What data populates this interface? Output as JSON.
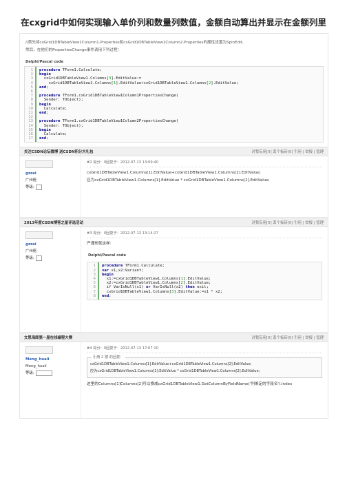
{
  "title": "在cxgrid中如何实现输入单价列和数量列数值，金额自动算出并显示在金额列里",
  "intro": [
    "//首先将cxGrid1DBTableView1Column1.Properties和cxGrid1DBTableView1Column2.Properties的属性设置为SpinEdit,",
    "然后，在他们的PropertiesChange事件调用下列过程："
  ],
  "code1": {
    "label": "Delphi/Pascal code",
    "line_numbers": "1\n2\n3\n4\n5\n6\n7\n8\n9\n10\n11\n12\n13\n14\n15\n16\n17"
  },
  "posts": [
    {
      "bar_left": "关注CSDN论坛微博 送CSDN积分大礼包",
      "bar_right": "对我有用[0]  丢个板砖[0]  引用 | 举报 | 管理",
      "user": "gzzai",
      "place": "广州佬",
      "level_label": "等级:",
      "meta": "#2 得分：0回复于：2012-07-13 13:09:40",
      "lines": [
        "cxGrid1DBTableView1.Columns[1].EditValue+cxGrid1DBTableView1.Columns[2].EditValue;",
        "应为cxGrid1DBTableView1.Columns[1].EditValue * cxGrid1DBTableView1.Columns[2].EditValue;"
      ]
    },
    {
      "bar_left": "2013年度CSDN博客之星评选活动",
      "bar_right": "对我有用[0]  丢个板砖[0]  引用 | 举报 | 管理",
      "user": "gzzai",
      "place": "广州佬",
      "level_label": "等级:",
      "meta": "#3 得分：0回复于：2012-07-13 13:14:27",
      "lines": [
        "严谨些就这样:"
      ],
      "code_label": "Delphi/Pascal code",
      "code_line_numbers": "1\n2\n3\n4\n5\n6\n7\n8"
    },
    {
      "bar_left": "文思海辉第一届在线编程大赛",
      "bar_right": "对我有用[0]  丢个板砖[0]  引用 | 举报 | 管理",
      "user": "Meng_huali",
      "place": "Meng_huali",
      "level_label": "等级:",
      "meta": "#4 得分：0回复于：2012-07-13 17:07:10",
      "quote_head": "引用 2 楼  的回复：",
      "quote_lines": [
        "cxGrid1DBTableView1.Columns[1].EditValue+cxGrid1DBTableView1.Columns[2].EditValue;",
        "应为cxGrid1DBTableView1.Columns[1].EditValue * cxGrid1DBTableView1.Columns[2].EditValue;"
      ],
      "after_quote": "这里的Columns[1]Columns[2]可以换成cxGrid1DBTableView1.GetColumnByFieldName('列绑定的字段名').Index"
    }
  ]
}
